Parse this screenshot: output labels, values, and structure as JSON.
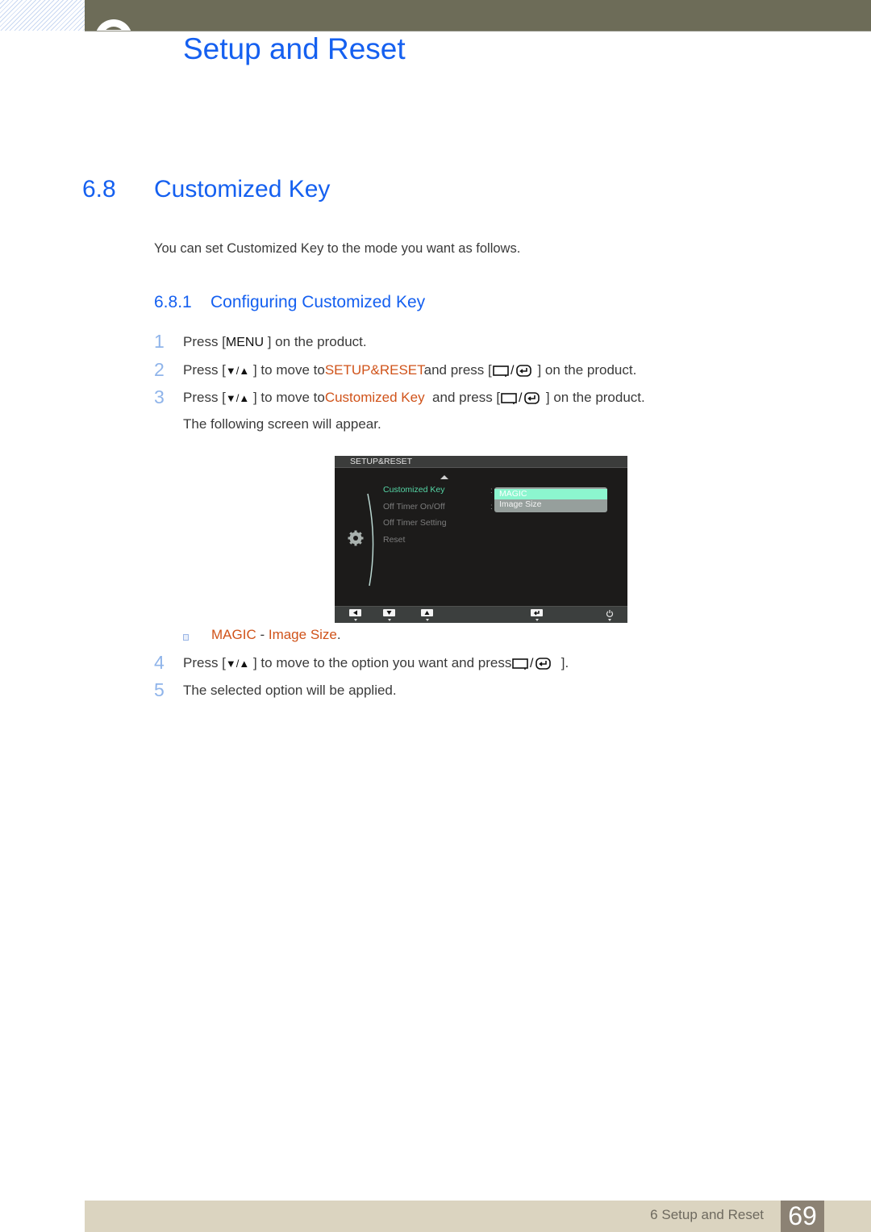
{
  "header": {
    "chapter_title": "Setup and Reset"
  },
  "section": {
    "number": "6.8",
    "title": "Customized Key",
    "intro": "You can set Customized Key to the mode you want as follows."
  },
  "subsection": {
    "number": "6.8.1",
    "title": "Configuring Customized Key"
  },
  "steps": [
    {
      "num": "1",
      "pre": "Press [",
      "key": "MENU",
      "post": " ] on the product."
    },
    {
      "num": "2",
      "pre": "Press [",
      "nav": "▼/▲",
      "mid": " ] to move to",
      "target": "SETUP&RESET",
      "and": "and press [",
      "end": " ] on the product."
    },
    {
      "num": "3",
      "pre": "Press [",
      "nav": "▼/▲",
      "mid": " ] to move to",
      "target": "Customized Key",
      "and": "  and press [",
      "end": " ] on the product."
    },
    {
      "num": "4",
      "pre": "Press [",
      "nav": "▼/▲",
      "mid": " ] to move to the option you want and press",
      "end": "  ]."
    },
    {
      "num": "5",
      "text": "The selected option will be applied."
    }
  ],
  "follow_text": "The following screen will appear.",
  "osd": {
    "title": "SETUP&RESET",
    "menu_items": [
      {
        "label": "Customized Key",
        "active": true
      },
      {
        "label": "Off Timer On/Off",
        "active": false
      },
      {
        "label": "Off Timer Setting",
        "active": false
      },
      {
        "label": "Reset",
        "active": false
      }
    ],
    "options": [
      {
        "label": "MAGIC",
        "selected": true
      },
      {
        "label": "Image Size",
        "selected": false
      }
    ],
    "footer_buttons": [
      "back-icon",
      "down-icon",
      "up-icon",
      "enter-icon",
      "power-icon"
    ],
    "colors": {
      "active": "#55d6a6",
      "selected_option": "#8cf6cf",
      "option_bg": "#969f9c"
    }
  },
  "note": {
    "first": "MAGIC",
    "sep": " - ",
    "second": "Image Size",
    "end": "."
  },
  "footer": {
    "label": "6 Setup and Reset",
    "page": "69"
  },
  "colors": {
    "heading": "#1560f0",
    "highlight": "#d0531a",
    "step_number": "#8fb4ea",
    "band": "#6d6c58",
    "footer_bg": "#dbd4c0",
    "page_box": "#8c8274"
  }
}
